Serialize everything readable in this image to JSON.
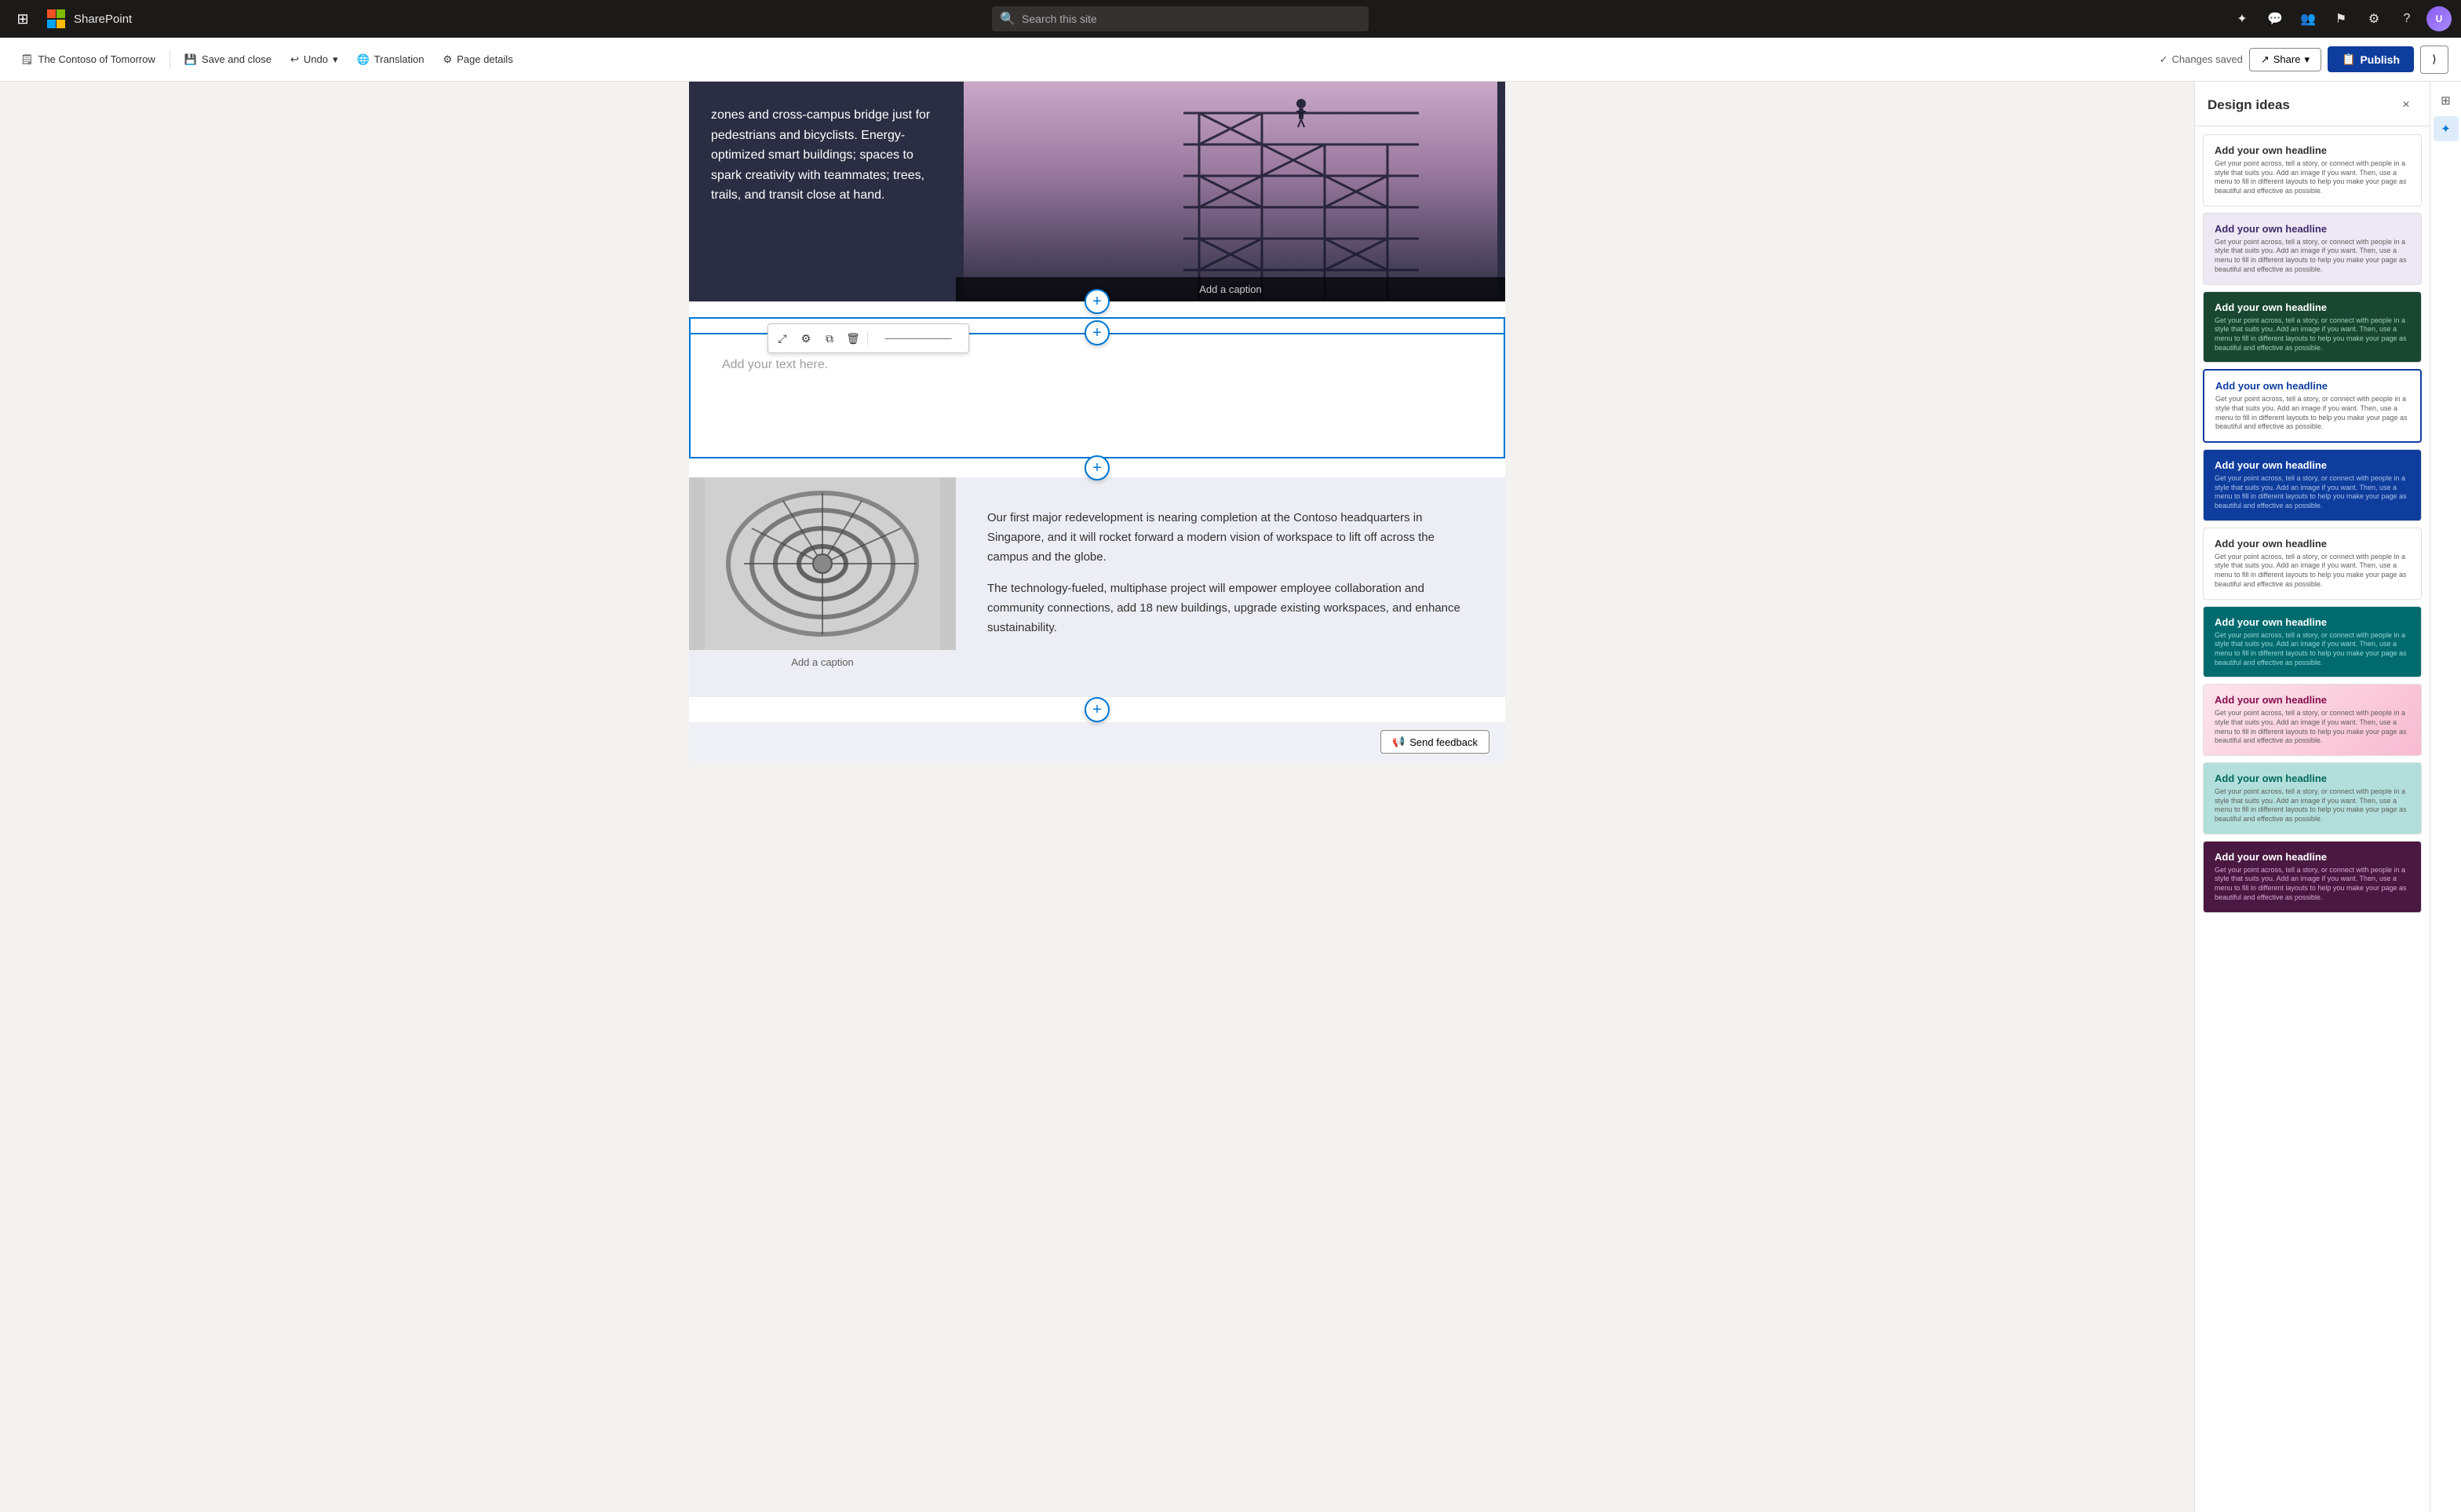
{
  "app": {
    "waffle_icon": "⊞",
    "app_name": "SharePoint"
  },
  "search": {
    "placeholder": "Search this site"
  },
  "nav_icons": [
    {
      "name": "copilot-icon",
      "symbol": "✦"
    },
    {
      "name": "chat-icon",
      "symbol": "💬"
    },
    {
      "name": "people-icon",
      "symbol": "👥"
    },
    {
      "name": "flag-icon",
      "symbol": "⚑"
    },
    {
      "name": "settings-icon",
      "symbol": "⚙"
    },
    {
      "name": "help-icon",
      "symbol": "?"
    }
  ],
  "toolbar": {
    "breadcrumb_label": "The Contoso of Tomorrow",
    "save_close_label": "Save and close",
    "undo_label": "Undo",
    "translation_label": "Translation",
    "page_details_label": "Page details",
    "changes_saved_label": "Changes saved",
    "share_label": "Share",
    "publish_label": "Publish"
  },
  "content": {
    "hero_text": "zones and cross-campus bridge just for pedestrians and bicyclists. Energy-optimized smart buildings; spaces to spark creativity with teammates; trees, trails, and transit close at hand.",
    "caption_top": "Add a caption",
    "text_placeholder": "Add your text here.",
    "bottom_caption": "Add a caption",
    "bottom_para1": "Our first major redevelopment is nearing completion at the Contoso headquarters in Singapore, and it will rocket forward a modern vision of workspace to lift off across the campus and the globe.",
    "bottom_para2": "The technology-fueled, multiphase project will empower employee collaboration and community connections, add 18 new buildings, upgrade existing workspaces, and enhance sustainability."
  },
  "design_panel": {
    "title": "Design ideas",
    "close_label": "×",
    "ideas": [
      {
        "title": "Add your own headline",
        "body": "Get your point across, tell a story, or connect with people in a style that suits you. Add an image if you want. Then, use a menu to fill in different layouts to help you make your page as beautiful and effective as possible.",
        "style": "card-white"
      },
      {
        "title": "Add your own headline",
        "body": "Get your point across, tell a story, or connect with people in a style that suits you. Add an image if you want. Then, use a menu to fill in different layouts to help you make your page as beautiful and effective as possible.",
        "style": "card-light-purple"
      },
      {
        "title": "Add your own headline",
        "body": "Get your point across, tell a story, or connect with people in a style that suits you. Add an image if you want. Then, use a menu to fill in different layouts to help you make your page as beautiful and effective as possible.",
        "style": "card-dark-green"
      },
      {
        "title": "Add your own headline",
        "body": "Get your point across, tell a story, or connect with people in a style that suits you. Add an image if you want. Then, use a menu to fill in different layouts to help you make your page as beautiful and effective as possible.",
        "style": "card-blue-outline"
      },
      {
        "title": "Add your own headline",
        "body": "Get your point across, tell a story, or connect with people in a style that suits you. Add an image if you want. Then, use a menu to fill in different layouts to help you make your page as beautiful and effective as possible.",
        "style": "card-dark-navy"
      },
      {
        "title": "Add your own headline",
        "body": "Get your point across, tell a story, or connect with people in a style that suits you. Add an image if you want. Then, use a menu to fill in different layouts to help you make your page as beautiful and effective as possible.",
        "style": "card-plain"
      },
      {
        "title": "Add your own headline",
        "body": "Get your point across, tell a story, or connect with people in a style that suits you. Add an image if you want. Then, use a menu to fill in different layouts to help you make your page as beautiful and effective as possible.",
        "style": "card-teal"
      },
      {
        "title": "Add your own headline",
        "body": "Get your point across, tell a story, or connect with people in a style that suits you. Add an image if you want. Then, use a menu to fill in different layouts to help you make your page as beautiful and effective as possible.",
        "style": "card-pink-gradient"
      },
      {
        "title": "Add your own headline",
        "body": "Get your point across, tell a story, or connect with people in a style that suits you. Add an image if you want. Then, use a menu to fill in different layouts to help you make your page as beautiful and effective as possible.",
        "style": "card-teal-green"
      },
      {
        "title": "Add your own headline",
        "body": "Get your point across, tell a story, or connect with people in a style that suits you. Add an image if you want. Then, use a menu to fill in different layouts to help you make your page as beautiful and effective as possible.",
        "style": "card-purple-dark"
      }
    ]
  },
  "feedback": {
    "label": "Send feedback",
    "icon": "📢"
  },
  "section_toolbar": {
    "move_icon": "⤢",
    "properties_icon": "⚙",
    "duplicate_icon": "⧉",
    "delete_icon": "🗑"
  }
}
